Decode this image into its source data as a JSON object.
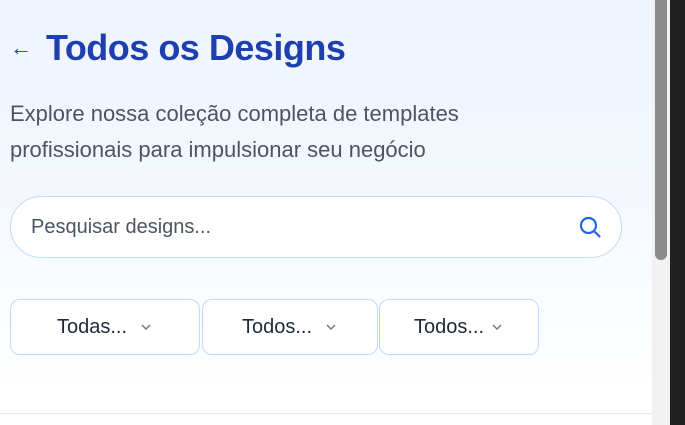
{
  "header": {
    "back_icon": "arrow-left-icon",
    "back_glyph": "←",
    "title": "Todos os Designs"
  },
  "subtitle": "Explore nossa coleção completa de templates profissionais para impulsionar seu negócio",
  "search": {
    "value": "",
    "placeholder": "Pesquisar designs...",
    "icon": "search-icon"
  },
  "filters": [
    {
      "label": "Todas...",
      "icon": "chevron-down-icon"
    },
    {
      "label": "Todos...",
      "icon": "chevron-down-icon"
    },
    {
      "label": "Todos...",
      "icon": "chevron-down-icon"
    }
  ],
  "colors": {
    "accent": "#1e40af",
    "border": "#bfdbfe",
    "text": "#4b5563",
    "search_icon": "#2563eb"
  }
}
